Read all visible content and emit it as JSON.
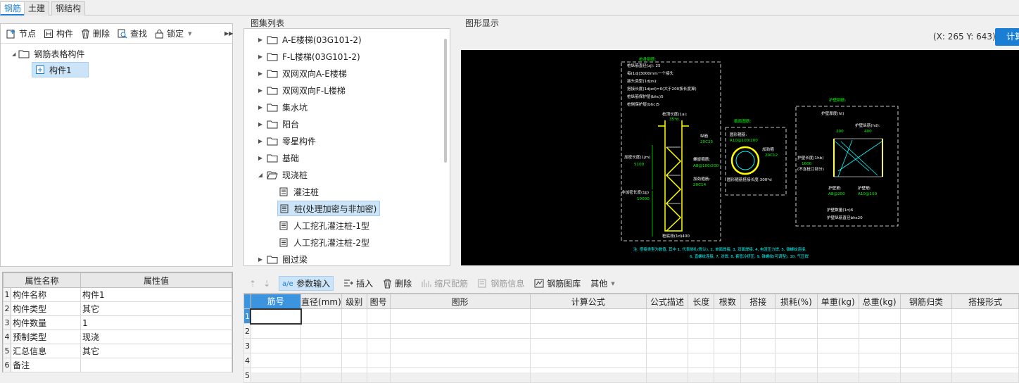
{
  "top_tabs": [
    "钢筋",
    "土建",
    "钢结构"
  ],
  "left_toolbar": {
    "node": "节点",
    "component": "构件",
    "delete": "删除",
    "find": "查找",
    "lock": "锁定"
  },
  "left_tree": {
    "root": "钢筋表格构件",
    "child": "构件1"
  },
  "property_table": {
    "headers": [
      "属性名称",
      "属性值"
    ],
    "rows": [
      {
        "index": "1",
        "name": "构件名称",
        "value": "构件1"
      },
      {
        "index": "2",
        "name": "构件类型",
        "value": "其它"
      },
      {
        "index": "3",
        "name": "构件数量",
        "value": "1"
      },
      {
        "index": "4",
        "name": "预制类型",
        "value": "现浇"
      },
      {
        "index": "5",
        "name": "汇总信息",
        "value": "其它"
      },
      {
        "index": "6",
        "name": "备注",
        "value": ""
      }
    ]
  },
  "atlas": {
    "title": "图集列表",
    "folders": [
      "A-E楼梯(03G101-2)",
      "F-L楼梯(03G101-2)",
      "双网双向A-E楼梯",
      "双网双向F-L楼梯",
      "集水坑",
      "阳台",
      "零星构件",
      "基础"
    ],
    "open_folder": "现浇桩",
    "files": [
      "灌注桩",
      "桩(处理加密与非加密)",
      "人工挖孔灌注桩-1型",
      "人工挖孔灌注桩-2型"
    ],
    "last_folder": "圈过梁"
  },
  "graphic": {
    "title": "图形显示",
    "coord": "(X: 265 Y: 643)",
    "calc_button": "计算",
    "drawing": {
      "t1": "桩身钢筋:",
      "t2": "桩纵筋直径(zj): 25",
      "t3": "每(1dj)3000mm一个接头",
      "t4": "接头类型(1djzs):",
      "t5": "搭接长度(1djzd)=0(大于200按长度算)",
      "t6": "桩纵筋保护层(bhc)5",
      "t7": "桩侧保护层(bhc)5",
      "t8": "桩顶长度(1a):",
      "t9": "35*d",
      "t10": "纵筋",
      "t11": "20C25",
      "t12": "螺旋箍筋:",
      "t13": "A8@100/200",
      "t14": "加密长度(1jm)",
      "t15": "5100",
      "t16": "加劲箍筋:",
      "t17": "20C14",
      "t18": "非加密长度(1jj)",
      "t19": "10000",
      "t20": "桩底段(1d)400",
      "t21": "截面图筋:",
      "t22": "圆形箍筋:",
      "t23": "A10@100/200",
      "t24": "加劲箍",
      "t25": "20C12",
      "t26": "圆形箍筋搭接长度:300*d",
      "t27": "护壁钢筋:",
      "t28": "护壁厚度(ht)",
      "t29": "护壁纵筋(hd):",
      "t30": "200",
      "t31": "400",
      "t32": "护壁长度(1hb)",
      "t33": "1600",
      "t34": "(不含桩口部分)",
      "t35": "护壁筋:",
      "t36": "护壁筋:",
      "t37": "A8@200",
      "t38": "A10@150",
      "t39": "护壁数量(1n)6",
      "t40": "护壁纵筋直径bhs20",
      "note1": "注: 搭接类型为数值, 其中 1, 代表绑扎(默认), 2, 单面焊接, 3, 双面焊接, 4, 电渣压力焊, 5, 锥螺纹连接,",
      "note2": "6, 直螺纹连接, 7, 对焊, 8, 套管冷挤压, 9, 锥螺纹(可调型), 10, 气压焊"
    }
  },
  "bottom_toolbar": {
    "param_input": "参数输入",
    "insert": "插入",
    "delete": "删除",
    "scale": "缩尺配筋",
    "rebar_info": "钢筋信息",
    "rebar_lib": "钢筋图库",
    "other": "其他"
  },
  "grid": {
    "headers": [
      "筋号",
      "直径(mm)",
      "级别",
      "图号",
      "图形",
      "计算公式",
      "公式描述",
      "长度",
      "根数",
      "搭接",
      "损耗(%)",
      "单重(kg)",
      "总重(kg)",
      "钢筋归类",
      "搭接形式"
    ],
    "rows": [
      "1",
      "2",
      "3",
      "4",
      "5"
    ]
  }
}
